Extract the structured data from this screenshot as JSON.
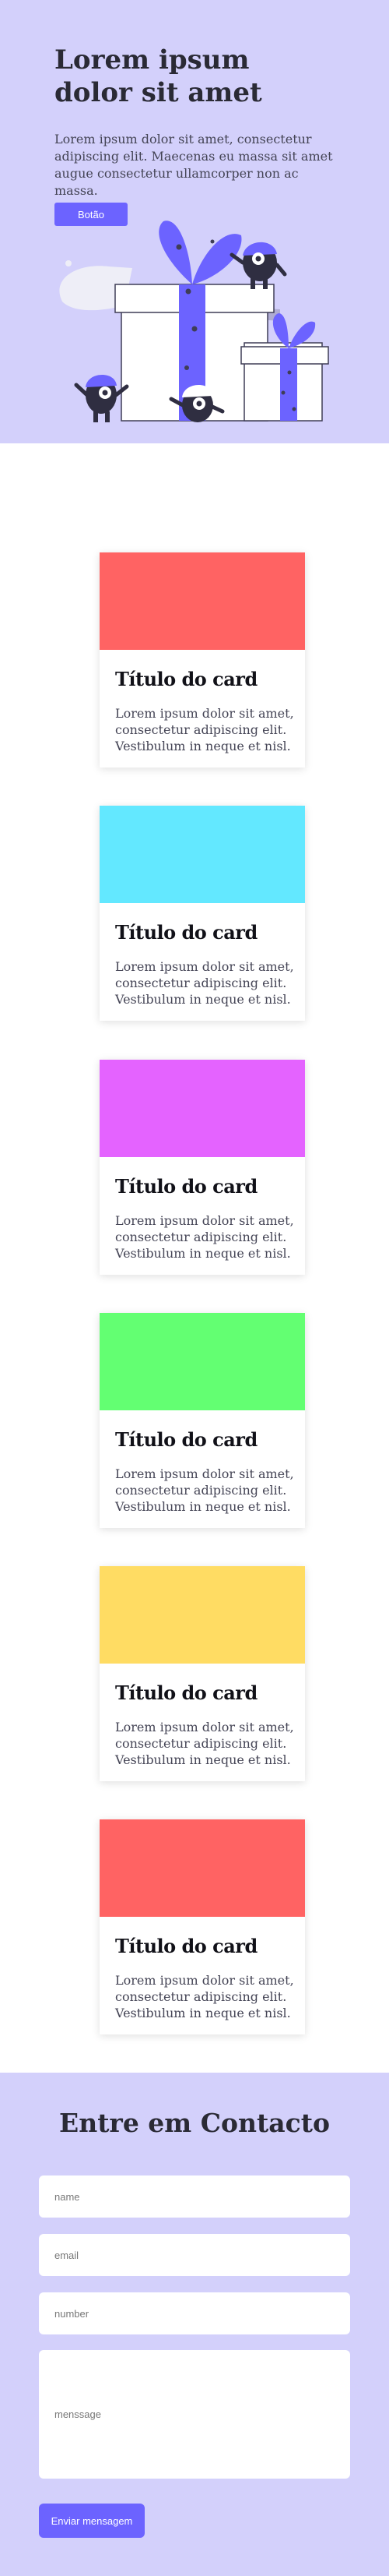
{
  "hero": {
    "title": "Lorem ipsum dolor sit amet",
    "text": "Lorem ipsum dolor sit amet, consectetur adipiscing elit. Maecenas eu massa sit amet augue consectetur ullamcorper non ac massa.",
    "button_label": "Botão"
  },
  "colors": {
    "background_lilac": "#d3d0fb",
    "accent": "#6c63ff"
  },
  "cards": [
    {
      "title": "Título do card",
      "text": "Lorem ipsum dolor sit amet, consectetur adipiscing elit. Vestibulum in neque et nisl.",
      "color": "#ff6363"
    },
    {
      "title": "Título do card",
      "text": "Lorem ipsum dolor sit amet, consectetur adipiscing elit. Vestibulum in neque et nisl.",
      "color": "#63e8ff"
    },
    {
      "title": "Título do card",
      "text": "Lorem ipsum dolor sit amet, consectetur adipiscing elit. Vestibulum in neque et nisl.",
      "color": "#e463ff"
    },
    {
      "title": "Título do card",
      "text": "Lorem ipsum dolor sit amet, consectetur adipiscing elit. Vestibulum in neque et nisl.",
      "color": "#63ff72"
    },
    {
      "title": "Título do card",
      "text": "Lorem ipsum dolor sit amet, consectetur adipiscing elit. Vestibulum in neque et nisl.",
      "color": "#ffdc63"
    },
    {
      "title": "Título do card",
      "text": "Lorem ipsum dolor sit amet, consectetur adipiscing elit. Vestibulum in neque et nisl.",
      "color": "#ff6363"
    }
  ],
  "contact": {
    "title": "Entre em Contacto",
    "name_placeholder": "name",
    "email_placeholder": "email",
    "number_placeholder": "number",
    "message_placeholder": "menssage",
    "submit_label": "Enviar mensagem"
  }
}
